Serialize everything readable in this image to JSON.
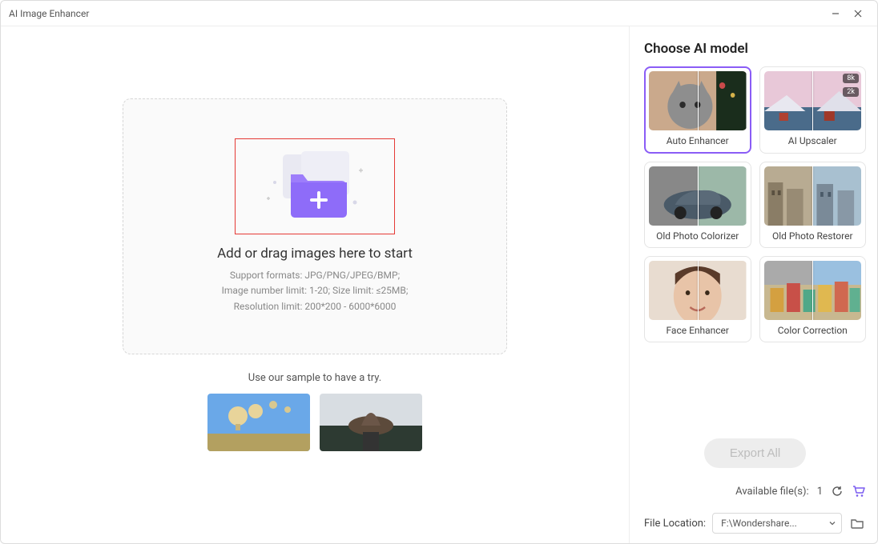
{
  "window": {
    "title": "AI Image Enhancer"
  },
  "dropzone": {
    "title": "Add or drag images here to start",
    "line1": "Support formats: JPG/PNG/JPEG/BMP;",
    "line2": "Image number limit: 1-20; Size limit: ≤25MB;",
    "line3": "Resolution limit: 200*200 - 6000*6000"
  },
  "samples": {
    "label": "Use our sample to have a try."
  },
  "sidebar": {
    "title": "Choose AI model",
    "models": [
      {
        "label": "Auto Enhancer"
      },
      {
        "label": "AI Upscaler",
        "badge_hi": "8k",
        "badge_lo": "2k"
      },
      {
        "label": "Old Photo Colorizer"
      },
      {
        "label": "Old Photo Restorer"
      },
      {
        "label": "Face Enhancer"
      },
      {
        "label": "Color Correction"
      }
    ],
    "export_label": "Export All",
    "available_label": "Available file(s):",
    "available_count": "1",
    "file_location_label": "File Location:",
    "file_location_value": "F:\\Wondershare..."
  }
}
